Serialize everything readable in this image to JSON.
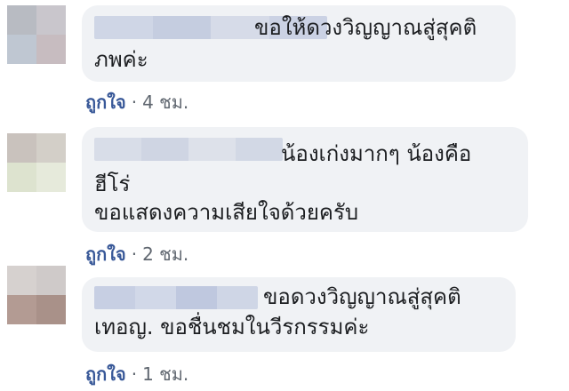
{
  "comments": [
    {
      "text_lines": [
        "ขอให้ดวงวิญญาณสู่สุคติ",
        "ภพค่ะ"
      ],
      "like_label": "ถูกใจ",
      "separator": "·",
      "time": "4 ชม.",
      "avatar_colors": [
        "#b8bbc2",
        "#c9c6cc",
        "#bfc7d2",
        "#c7bcc0"
      ],
      "name_blur_colors": [
        "#cfd6e6",
        "#c5cde0",
        "#d6dbe8",
        "#cbd2e4"
      ]
    },
    {
      "text_lines": [
        "น้องเก่งมากๆ น้องคือ",
        "ฮีโร่",
        "ขอแสดงความเสียใจด้วยครับ"
      ],
      "like_label": "ถูกใจ",
      "separator": "·",
      "time": "2 ชม.",
      "avatar_colors": [
        "#c9c2bd",
        "#d3cfc8",
        "#dde3cf",
        "#e6eadb"
      ],
      "name_blur_colors": [
        "#d8dde8",
        "#cfd5e3",
        "#dde1ea",
        "#d2d8e5"
      ]
    },
    {
      "text_lines": [
        "ขอดวงวิญญาณสู่สุคติ",
        "เทอญ. ขอชื่นชมในวีรกรรมค่ะ"
      ],
      "like_label": "ถูกใจ",
      "separator": "·",
      "time": "1 ชม.",
      "avatar_colors": [
        "#d6d1cf",
        "#cfcac9",
        "#b39b93",
        "#a99189"
      ],
      "name_blur_colors": [
        "#c7cfe3",
        "#d1d8e8",
        "#bfc8df",
        "#cfd6e6"
      ]
    }
  ]
}
